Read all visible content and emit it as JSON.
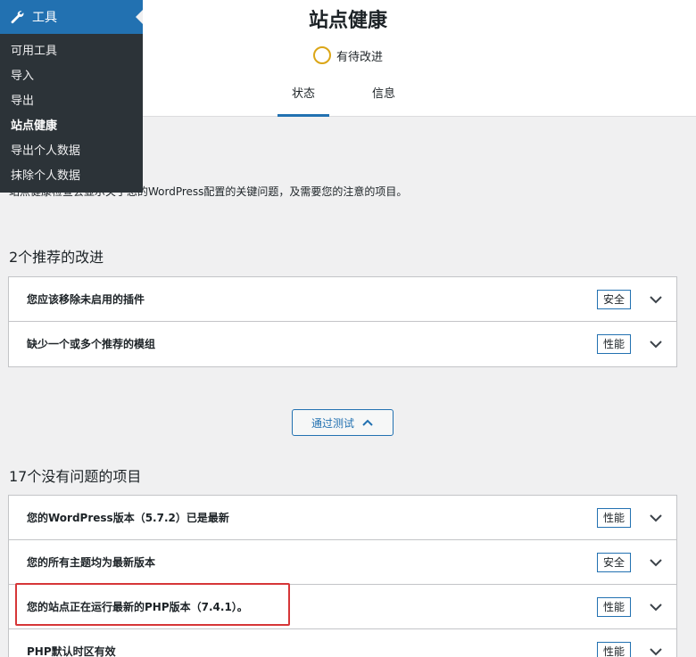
{
  "header": {
    "title": "站点健康",
    "status_text": "有待改进",
    "tabs": [
      {
        "label": "状态"
      },
      {
        "label": "信息"
      }
    ]
  },
  "description": "站点健康检查会显示关于您的WordPress配置的关键问题，及需要您的注意的项目。",
  "recommended": {
    "heading": "2个推荐的改进",
    "items": [
      {
        "label": "您应该移除未启用的插件",
        "badge": "安全"
      },
      {
        "label": "缺少一个或多个推荐的模组",
        "badge": "性能"
      }
    ]
  },
  "passed_button": {
    "label": "通过测试"
  },
  "passed": {
    "heading": "17个没有问题的项目",
    "items": [
      {
        "label": "您的WordPress版本（5.7.2）已是最新",
        "badge": "性能"
      },
      {
        "label": "您的所有主题均为最新版本",
        "badge": "安全"
      },
      {
        "label": "您的站点正在运行最新的PHP版本（7.4.1）。",
        "badge": "性能"
      },
      {
        "label": "PHP默认时区有效",
        "badge": "性能"
      }
    ]
  },
  "menu": {
    "title": "工具",
    "items": [
      {
        "label": "可用工具"
      },
      {
        "label": "导入"
      },
      {
        "label": "导出"
      },
      {
        "label": "站点健康"
      },
      {
        "label": "导出个人数据"
      },
      {
        "label": "抹除个人数据"
      }
    ]
  },
  "colors": {
    "accent": "#2271b1",
    "status_ring": "#dba617",
    "highlight": "#d63638",
    "menu_bg": "#2c3338"
  }
}
